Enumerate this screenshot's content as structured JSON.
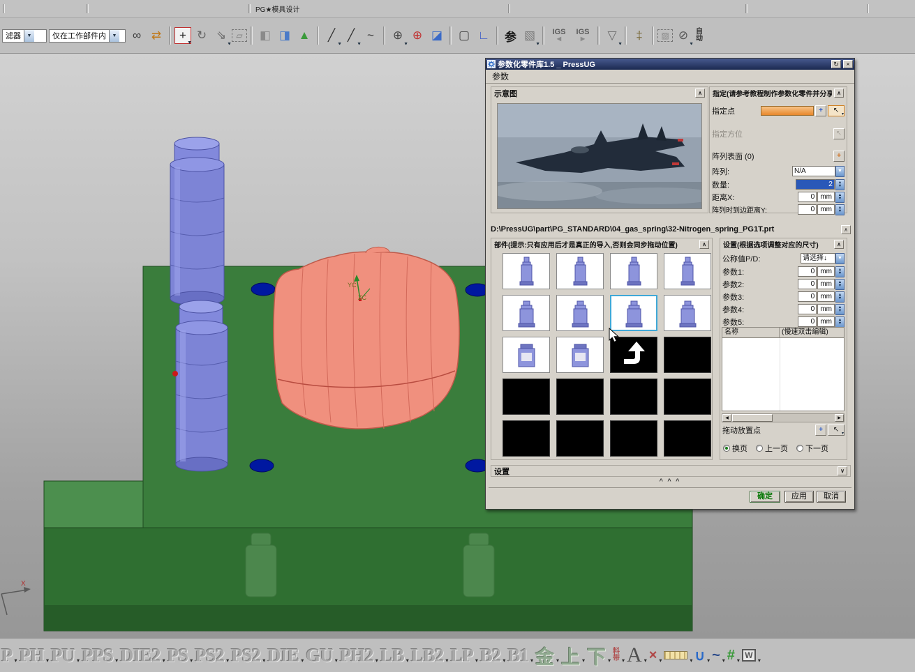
{
  "glyphs": {
    "combo": "▼",
    "up": "∧",
    "down": "∨",
    "spin_up": "▲",
    "spin_down": "▼",
    "left": "◀",
    "right": "▶",
    "restore": "↻",
    "close": "×",
    "dd_small": "▾",
    "plus": "+",
    "cursor": "↖"
  },
  "top_strip": {
    "label": "PG★模具设计"
  },
  "top_toolbar": {
    "filter_value": "滤器",
    "scope_value": "仅在工作部件内",
    "icons": [
      {
        "name": "chain-link-icon",
        "glyph": "∞",
        "color": "#3a3a3a"
      },
      {
        "name": "reverse-direction-icon",
        "glyph": "⇄",
        "color": "#c07818"
      },
      {
        "type": "sep"
      },
      {
        "name": "snap-point-icon",
        "glyph": "+",
        "color": "#222",
        "box": "red",
        "dd": true
      },
      {
        "name": "rotate-point-icon",
        "glyph": "↻",
        "color": "#666"
      },
      {
        "name": "drag-point-icon",
        "glyph": "⇘",
        "color": "#666",
        "dd": true
      },
      {
        "name": "lasso-select-icon",
        "glyph": "▱",
        "color": "#777",
        "box": "dash"
      },
      {
        "type": "sep"
      },
      {
        "name": "wireframe-cube-icon",
        "glyph": "◧",
        "color": "#8a8a8a"
      },
      {
        "name": "shaded-cube-icon",
        "glyph": "◨",
        "color": "#4a7ac8"
      },
      {
        "name": "triad-icon",
        "glyph": "▲",
        "color": "#3a9a3a"
      },
      {
        "type": "sep"
      },
      {
        "name": "line-icon",
        "glyph": "╱",
        "color": "#333",
        "dd": true
      },
      {
        "name": "line-point-icon",
        "glyph": "╱",
        "color": "#333",
        "dd": true
      },
      {
        "name": "curve-hook-icon",
        "glyph": "~",
        "color": "#333"
      },
      {
        "type": "sep"
      },
      {
        "name": "datum-axis-icon",
        "glyph": "⊕",
        "color": "#444",
        "dd": true
      },
      {
        "name": "datum-csys-icon",
        "glyph": "⊕",
        "color": "#c03030"
      },
      {
        "name": "section-cut-icon",
        "glyph": "◪",
        "color": "#3a6ac8"
      },
      {
        "type": "sep"
      },
      {
        "name": "fit-view-icon",
        "glyph": "▢",
        "color": "#444"
      },
      {
        "name": "corner-snap-icon",
        "glyph": "∟",
        "color": "#3a5ac8"
      },
      {
        "type": "sep"
      },
      {
        "type": "text",
        "name": "can-reference-button",
        "label": "参"
      },
      {
        "name": "extract-cube-icon",
        "glyph": "▧",
        "color": "#777",
        "dd": true
      },
      {
        "type": "sep"
      },
      {
        "type": "igs",
        "name": "igs-import-button",
        "label": "IGS",
        "arrow": "◀"
      },
      {
        "type": "igs",
        "name": "igs-export-button",
        "label": "IGS",
        "arrow": "▶"
      },
      {
        "type": "sep"
      },
      {
        "name": "funnel-icon",
        "glyph": "▽",
        "color": "#6a6a6a",
        "dd": true
      },
      {
        "type": "sep"
      },
      {
        "name": "pin-icon",
        "glyph": "‡",
        "color": "#7a6a3a"
      },
      {
        "type": "sep"
      },
      {
        "name": "image-frame-icon",
        "glyph": "▨",
        "color": "#888",
        "box": "dash"
      },
      {
        "name": "circle-slash-icon",
        "glyph": "⊘",
        "color": "#555",
        "dd": true
      },
      {
        "type": "text",
        "name": "auto-label",
        "label": "自动",
        "small": true
      }
    ]
  },
  "viewport": {
    "axes": {
      "x": "X",
      "yc": "YC",
      "zc": "ZC"
    }
  },
  "dialog": {
    "title": "参数化零件库1.5 _ PressUG",
    "menu": "参数",
    "unit": "mm",
    "schematic": {
      "header": "示意图"
    },
    "specify": {
      "header": "指定(请参考教程制作参数化零件并分享",
      "point_label": "指定点",
      "orient_label": "指定方位",
      "surface_label": "阵列表面 (0)",
      "array_label": "阵列:",
      "array_value": "N/A",
      "qty_label": "数量:",
      "qty_value": "2",
      "distx_label": "距离X:",
      "distx_value": "0",
      "disty_label": "阵列时到边距离Y:",
      "disty_value": "0"
    },
    "path": "D:\\PressUG\\part\\PG_STANDARD\\04_gas_spring\\32-Nitrogen_spring_PG1T.prt",
    "parts": {
      "header": "部件(提示:只有应用后才是真正的导入,否则会同步拖动位置)",
      "cells": [
        "tall",
        "tall",
        "tall",
        "tall",
        "mid",
        "mid",
        "mid-selected",
        "mid",
        "can",
        "can",
        "arrow",
        "black",
        "black",
        "black",
        "black",
        "black",
        "black",
        "black",
        "black",
        "black"
      ]
    },
    "settings": {
      "header": "设置(根据选项调整对应的尺寸)",
      "nominal_label": "公称值P/D:",
      "nominal_value": "请选择↓",
      "params": [
        {
          "label": "参数1:",
          "value": "0"
        },
        {
          "label": "参数2:",
          "value": "0"
        },
        {
          "label": "参数3:",
          "value": "0"
        },
        {
          "label": "参数4:",
          "value": "0"
        },
        {
          "label": "参数5:",
          "value": "0"
        }
      ],
      "table": {
        "col1": "名称",
        "col2": "(慢速双击编辑)"
      },
      "drag_label": "拖动放置点",
      "radios": [
        {
          "label": "换页",
          "checked": true
        },
        {
          "label": "上一页",
          "checked": false
        },
        {
          "label": "下一页",
          "checked": false
        }
      ]
    },
    "bottom_section": "设置",
    "collapse_handle": "^ ^ ^",
    "buttons": {
      "ok": "确定",
      "apply": "应用",
      "cancel": "取消"
    }
  },
  "bottom_toolbar": {
    "separator": "▾",
    "items": [
      {
        "label": "P",
        "style": "stamp",
        "name": "stamp-p"
      },
      {
        "label": "PH",
        "style": "stamp",
        "name": "stamp-ph"
      },
      {
        "label": "PU",
        "style": "stamp",
        "name": "stamp-pu"
      },
      {
        "label": "PPS",
        "style": "stamp",
        "name": "stamp-pps"
      },
      {
        "label": "DIE2",
        "style": "stamp",
        "name": "stamp-die2"
      },
      {
        "label": "PS",
        "style": "stamp",
        "name": "stamp-ps"
      },
      {
        "label": "PS2",
        "style": "stamp",
        "name": "stamp-ps2"
      },
      {
        "label": "PS2",
        "style": "stamp",
        "name": "stamp-ps2b"
      },
      {
        "label": "DIE",
        "style": "stamp",
        "name": "stamp-die"
      },
      {
        "label": "GU",
        "style": "stamp",
        "name": "stamp-gu"
      },
      {
        "label": "PH2",
        "style": "stamp",
        "name": "stamp-ph2"
      },
      {
        "label": "LB",
        "style": "stamp",
        "name": "stamp-lb"
      },
      {
        "label": "LB2",
        "style": "stamp",
        "name": "stamp-lb2"
      },
      {
        "label": "LP",
        "style": "stamp",
        "name": "stamp-lp"
      },
      {
        "label": "B2",
        "style": "stamp",
        "name": "stamp-b2"
      },
      {
        "label": "B1",
        "style": "stamp",
        "name": "stamp-b1"
      },
      {
        "label": "金",
        "style": "stamp-green",
        "name": "stamp-jin"
      },
      {
        "label": "上",
        "style": "stamp-green",
        "name": "stamp-shang"
      },
      {
        "label": "下",
        "style": "stamp-green",
        "name": "stamp-xia"
      },
      {
        "label": "料带",
        "style": "stack-red",
        "name": "label-liaodai"
      },
      {
        "label": "A",
        "style": "serif",
        "name": "text-annotation-button"
      },
      {
        "style": "icon",
        "name": "dimension-icon",
        "glyph": "×",
        "color": "#b04848"
      },
      {
        "style": "ruler",
        "name": "ruler-icon"
      },
      {
        "style": "icon",
        "name": "bucket-icon",
        "glyph": "∪",
        "color": "#2a6ac8"
      },
      {
        "style": "icon",
        "name": "swoosh-icon",
        "glyph": "~",
        "color": "#2a4a8a"
      },
      {
        "style": "icon",
        "name": "mesh-icon",
        "glyph": "#",
        "color": "#3a9a3a"
      },
      {
        "style": "docw",
        "name": "doc-w-icon",
        "glyph": "W"
      }
    ]
  }
}
